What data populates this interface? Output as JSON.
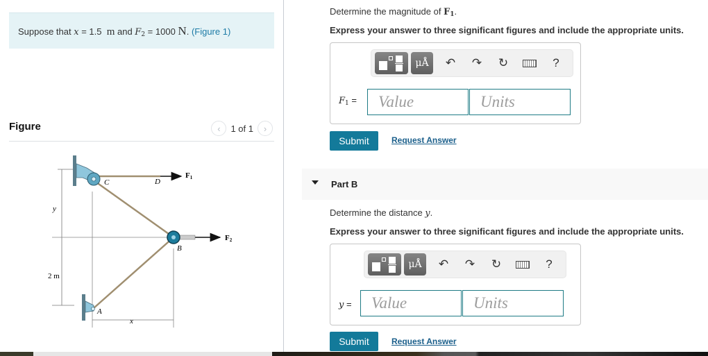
{
  "problem": {
    "prefix": "Suppose that ",
    "x_var": "x",
    "x_eq": " = 1.5 ",
    "x_unit": "m",
    "and": " and ",
    "f2_var": "F",
    "f2_sub": "2",
    "f2_eq": " = 1000 ",
    "f2_unit": "N",
    "period": ". ",
    "figure_link": "(Figure 1)"
  },
  "figure_panel": {
    "title": "Figure",
    "pager_text": "1 of 1",
    "prev_icon": "chevron-left",
    "next_icon": "chevron-right",
    "labels": {
      "C": "C",
      "D": "D",
      "B": "B",
      "A": "A",
      "F1": "F",
      "F1_sub": "1",
      "F2": "F",
      "F2_sub": "2",
      "y": "y",
      "x": "x",
      "two_m": "2 m"
    }
  },
  "part_a": {
    "question_prefix": "Determine the magnitude of ",
    "question_var": "F",
    "question_sub": "1",
    "question_suffix": ".",
    "instruction": "Express your answer to three significant figures and include the appropriate units.",
    "label_var": "F",
    "label_sub": "1",
    "label_eq": " =",
    "value_placeholder": "Value",
    "units_placeholder": "Units",
    "submit_label": "Submit",
    "request_label": "Request Answer"
  },
  "part_b": {
    "header": "Part B",
    "question_prefix": "Determine the distance ",
    "question_var": "y",
    "question_suffix": ".",
    "instruction": "Express your answer to three significant figures and include the appropriate units.",
    "label_var": "y",
    "label_eq": " =",
    "value_placeholder": "Value",
    "units_placeholder": "Units",
    "submit_label": "Submit",
    "request_label": "Request Answer"
  },
  "toolbar": {
    "units_label": "μÅ",
    "help_label": "?",
    "icons": [
      "templates-icon",
      "units-icon",
      "undo-icon",
      "redo-icon",
      "reset-icon",
      "keyboard-icon",
      "help-icon"
    ]
  },
  "colors": {
    "accent": "#137a9a",
    "link": "#1d7ba6",
    "info_bg": "#e5f3f6",
    "field_border": "#1e7b85"
  }
}
